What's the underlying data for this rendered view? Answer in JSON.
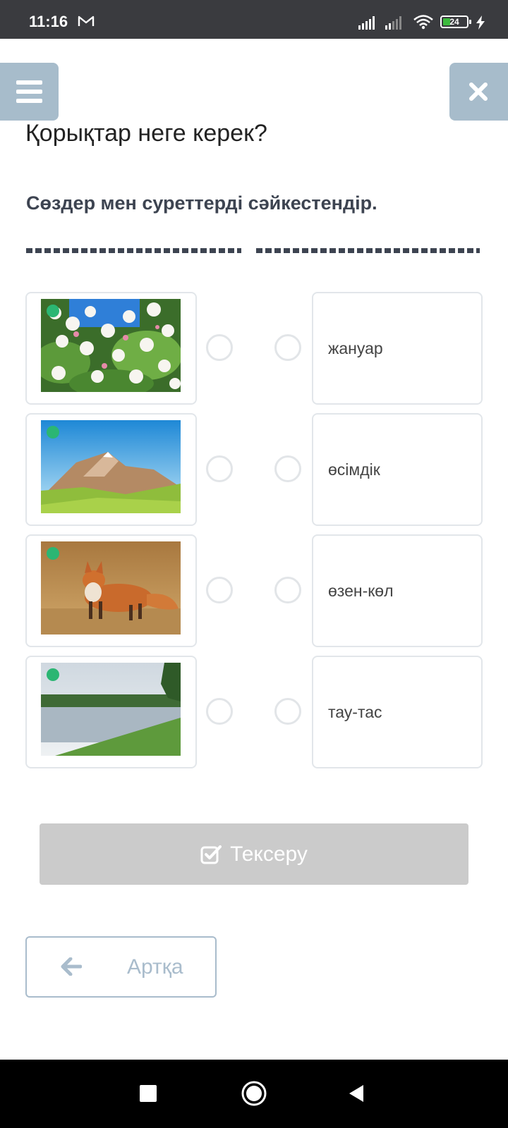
{
  "status_bar": {
    "time": "11:16",
    "battery_level": "24",
    "icons": [
      "gmail-icon",
      "signal-icon",
      "signal-icon",
      "wifi-icon",
      "battery-icon",
      "charging-icon"
    ]
  },
  "header": {
    "menu_icon": "hamburger-icon",
    "close_icon": "close-icon"
  },
  "quiz": {
    "title": "Қорықтар неге керек?",
    "instruction": "Сөздер мен суреттерді сәйкестендір.",
    "images": [
      {
        "subject": "apple blossom"
      },
      {
        "subject": "mountains"
      },
      {
        "subject": "fox"
      },
      {
        "subject": "river"
      }
    ],
    "words": [
      "жануар",
      "өсімдік",
      "өзен-көл",
      "тау-тас"
    ]
  },
  "actions": {
    "check_label": "Тексеру",
    "check_icon": "checkbox-icon",
    "back_label": "Артқа",
    "back_icon": "arrow-left-icon"
  },
  "colors": {
    "accent": "#a7bccb",
    "disabled_button": "#cbcbcb",
    "text_dark": "#3d4451"
  }
}
